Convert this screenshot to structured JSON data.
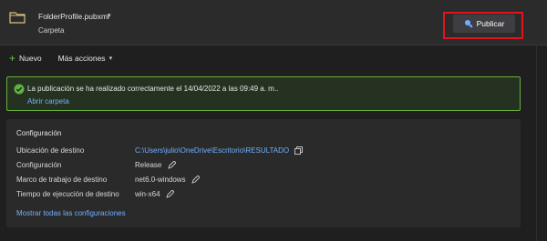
{
  "header": {
    "profile_name": "FolderProfile.pubxml",
    "profile_type": "Carpeta",
    "publish_label": "Publicar"
  },
  "toolbar": {
    "new_label": "Nuevo",
    "more_actions_label": "Más acciones"
  },
  "alert": {
    "message": "La publicación se ha realizado correctamente el 14/04/2022 a las 09:49 a. m..",
    "open_folder_label": "Abrir carpeta"
  },
  "config": {
    "title": "Configuración",
    "rows": [
      {
        "label": "Ubicación de destino",
        "value": "C:\\Users\\julio\\OneDrive\\Escritorio\\RESULTADO"
      },
      {
        "label": "Configuración",
        "value": "Release"
      },
      {
        "label": "Marco de trabajo de destino",
        "value": "net6.0-windows"
      },
      {
        "label": "Tiempo de ejecución de destino",
        "value": "win-x64"
      }
    ],
    "show_all_label": "Mostrar todas las configuraciones"
  },
  "icons": {
    "folder": "folder-icon",
    "publish": "publish-icon",
    "plus": "plus-icon",
    "check": "check-circle-icon",
    "copy": "copy-icon",
    "edit": "pencil-icon"
  },
  "colors": {
    "background": "#1f1f1f",
    "header": "#2b2b2b",
    "accent_link": "#6fb1ff",
    "success_border": "#66b03d",
    "highlight_border": "#e0141e"
  }
}
